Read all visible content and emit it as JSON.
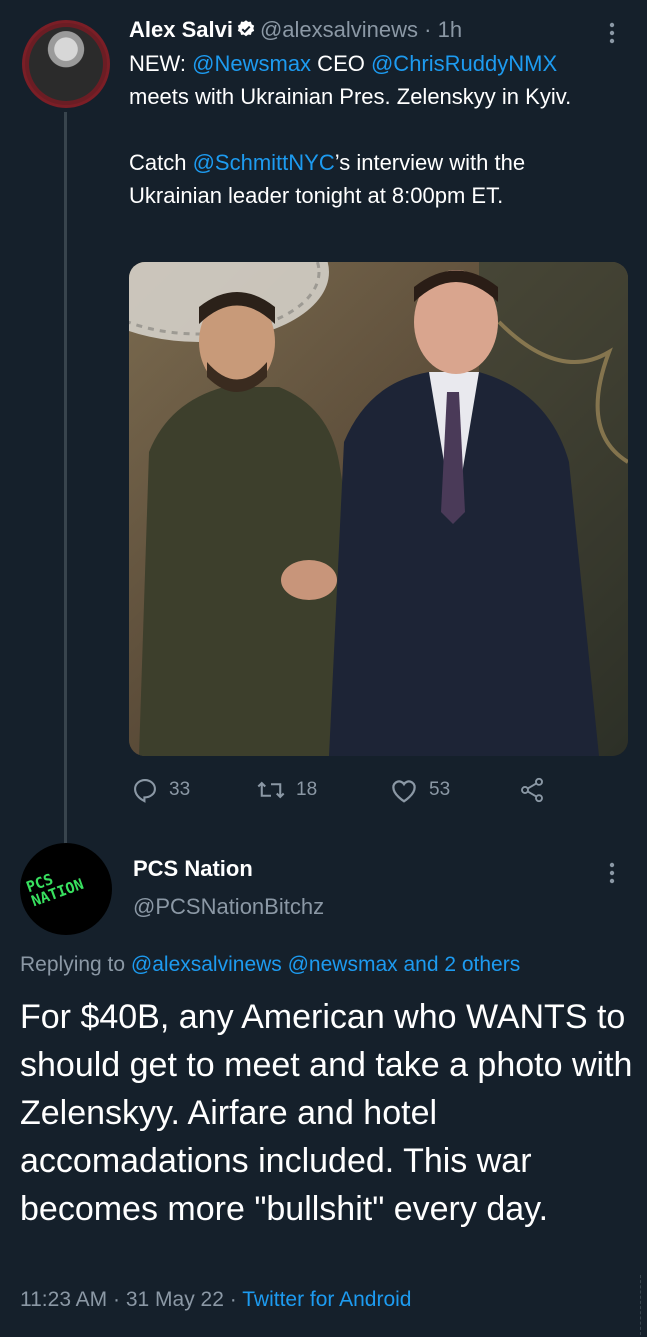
{
  "tweet": {
    "author_name": "Alex Salvi",
    "handle": "@alexsalvinews",
    "separator": "·",
    "time": "1h",
    "text_parts": {
      "p1_a": "NEW: ",
      "p1_mention1": "@Newsmax",
      "p1_b": " CEO ",
      "p1_mention2": "@ChrisRuddyNMX",
      "p1_c": " meets with Ukrainian Pres. Zelenskyy in Kyiv.",
      "p2_a": "Catch ",
      "p2_mention": "@SchmittNYC",
      "p2_b": "’s interview with the Ukrainian leader tonight at 8:00pm ET."
    },
    "stats": {
      "replies": "33",
      "retweets": "18",
      "likes": "53"
    }
  },
  "reply": {
    "author_name": "PCS Nation",
    "handle": "@PCSNationBitchz",
    "avatar_text": "PCS NATION",
    "replying_prefix": "Replying to ",
    "replying_to": "@alexsalvinews @newsmax and 2 others",
    "body": "For $40B, any American who WANTS to should get to meet and take a photo with Zelenskyy. Airfare and hotel accomadations included. This war becomes more \"bullshit\" every day.",
    "time": "11:23 AM",
    "separator": "·",
    "date": "31 May 22",
    "separator2": "·",
    "source": "Twitter for Android"
  },
  "colors": {
    "background": "#15202b",
    "accent": "#1d9bf0",
    "muted": "#8b98a5",
    "verified_badge": "#ffffff"
  },
  "icons": {
    "reply": "reply-icon",
    "retweet": "retweet-icon",
    "like": "like-icon",
    "share": "share-icon",
    "more": "more-vertical-icon",
    "verified": "verified-badge-icon"
  }
}
